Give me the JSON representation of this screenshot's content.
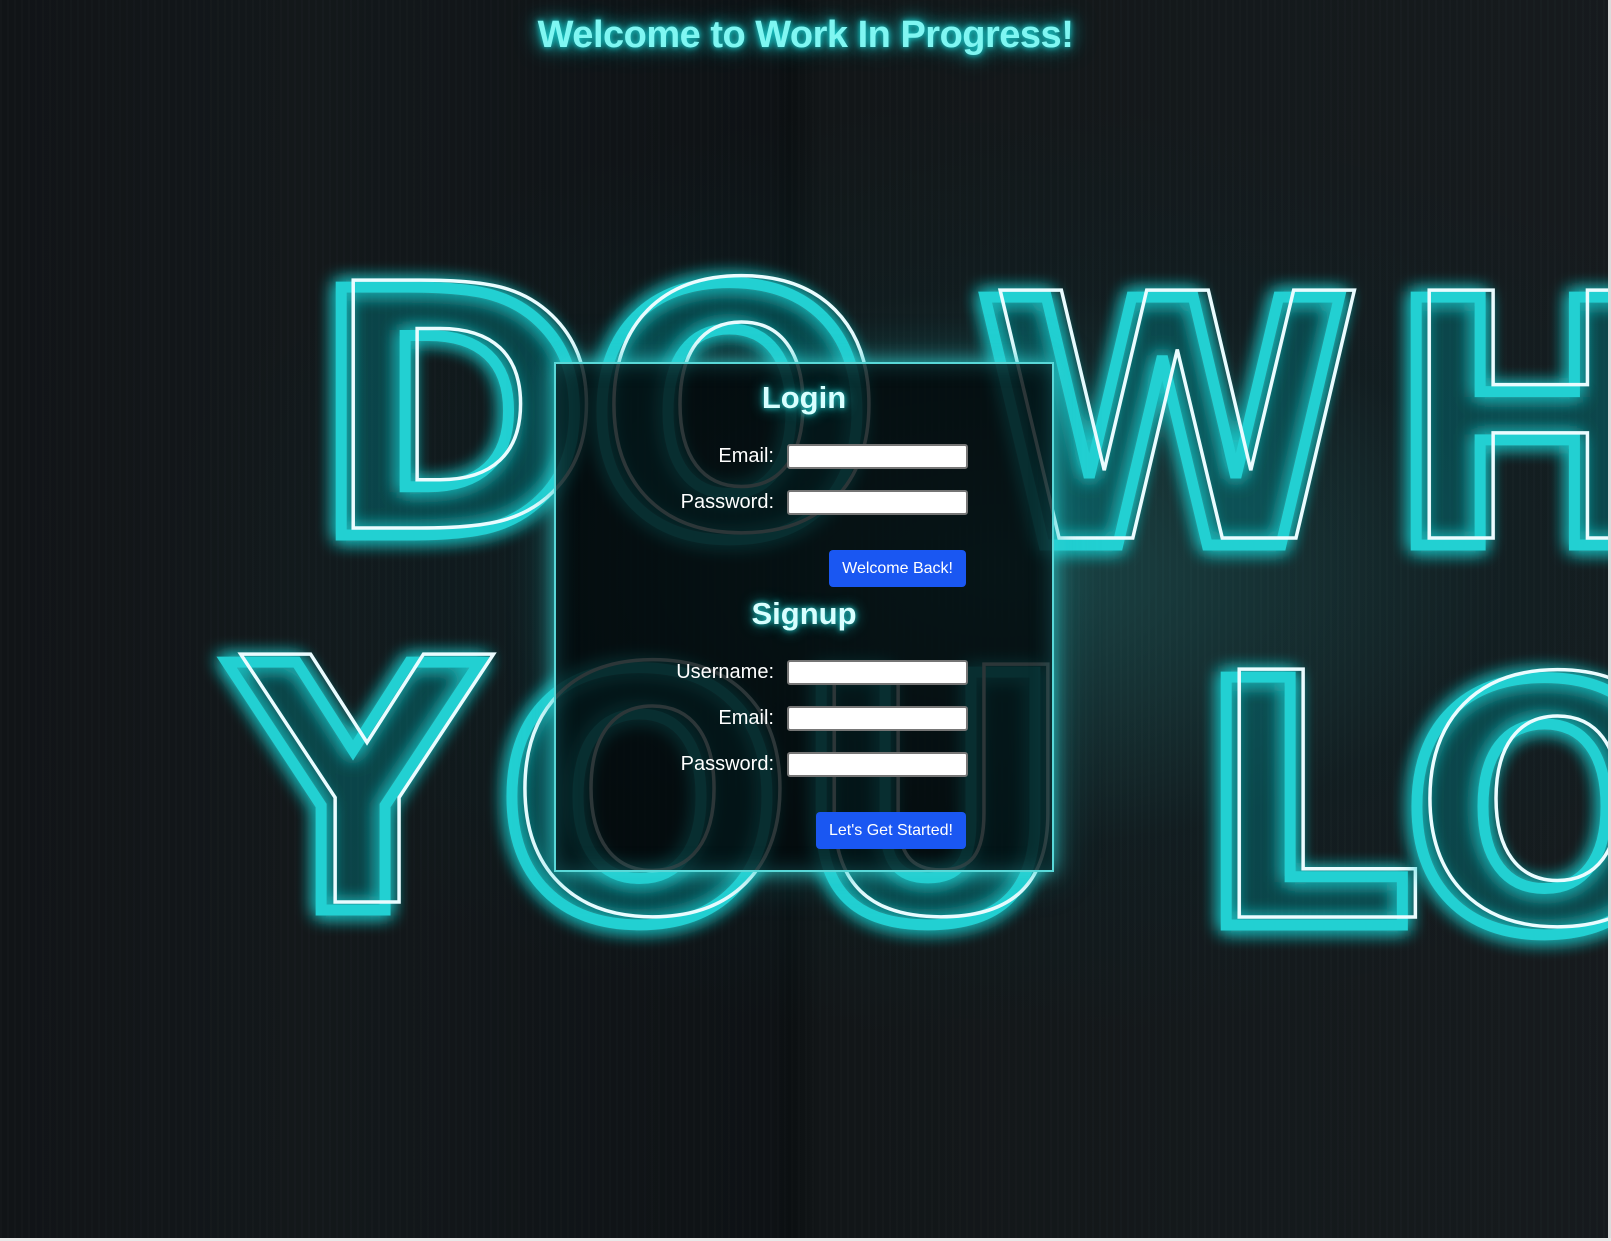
{
  "page": {
    "title": "Welcome to Work In Progress!"
  },
  "background": {
    "neon_row_1": [
      "D",
      "O",
      "W",
      "H"
    ],
    "neon_row_2": [
      "Y",
      "O",
      "U",
      "L",
      "O"
    ],
    "neon_color": "#22d0d2"
  },
  "login": {
    "heading": "Login",
    "email_label": "Email:",
    "email_value": "",
    "password_label": "Password:",
    "password_value": "",
    "submit_label": "Welcome Back!"
  },
  "signup": {
    "heading": "Signup",
    "username_label": "Username:",
    "username_value": "",
    "email_label": "Email:",
    "email_value": "",
    "password_label": "Password:",
    "password_value": "",
    "submit_label": "Let's Get Started!"
  },
  "colors": {
    "accent_button": "#1a57f2",
    "title_glow": "#7ff6f2",
    "panel_border": "#59d8d8"
  }
}
